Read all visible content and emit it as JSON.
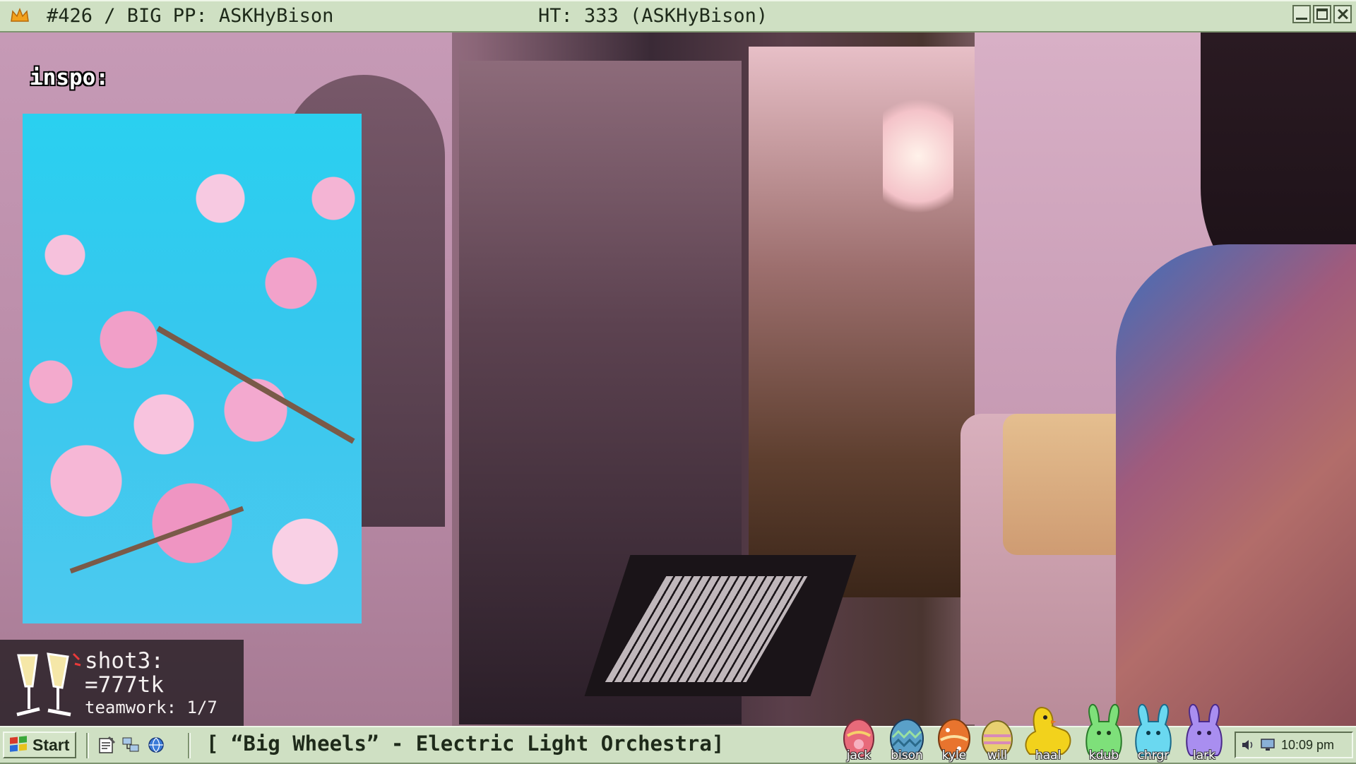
{
  "window": {
    "title_left": "#426 / BIG PP: ASKHyBison",
    "title_center": "HT: 333 (ASKHyBison)"
  },
  "inspo": {
    "label": "inspo:"
  },
  "shot_panel": {
    "line1": "shot3:",
    "line2": "=777tk",
    "line3": "teamwork: 1/7"
  },
  "taskbar": {
    "start_label": "Start",
    "now_playing": "[ “Big Wheels” - Electric Light Orchestra]",
    "clock": "10:09 pm",
    "mascots": [
      {
        "label": "jack",
        "icon": "easter-egg-icon",
        "color": "#e86a7a"
      },
      {
        "label": "bison",
        "icon": "easter-egg-icon",
        "color": "#5aa0c8"
      },
      {
        "label": "kyle",
        "icon": "easter-egg-icon",
        "color": "#e8742e"
      },
      {
        "label": "will",
        "icon": "easter-egg-icon",
        "color": "#e8d070"
      },
      {
        "label": "haal",
        "icon": "chick-icon",
        "color": "#f2d21c"
      },
      {
        "label": "kdub",
        "icon": "bunny-icon",
        "color": "#7ee07a"
      },
      {
        "label": "chrgr",
        "icon": "bunny-icon",
        "color": "#6ad8f0"
      },
      {
        "label": "lark",
        "icon": "bunny-icon",
        "color": "#a98ef0"
      }
    ]
  },
  "colors": {
    "chrome": "#cfe0c3",
    "chrome_dark": "#7e9470",
    "text": "#1e2a1a"
  }
}
